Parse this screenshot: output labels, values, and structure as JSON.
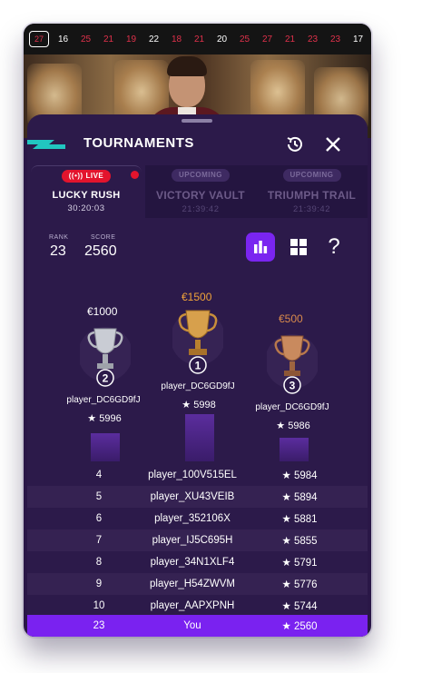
{
  "roulette_results": [
    {
      "n": "27",
      "color": "red"
    },
    {
      "n": "16",
      "color": "black"
    },
    {
      "n": "25",
      "color": "red"
    },
    {
      "n": "21",
      "color": "red"
    },
    {
      "n": "19",
      "color": "red"
    },
    {
      "n": "22",
      "color": "black"
    },
    {
      "n": "18",
      "color": "red"
    },
    {
      "n": "21",
      "color": "red"
    },
    {
      "n": "20",
      "color": "black"
    },
    {
      "n": "25",
      "color": "red"
    },
    {
      "n": "27",
      "color": "red"
    },
    {
      "n": "21",
      "color": "red"
    },
    {
      "n": "23",
      "color": "red"
    },
    {
      "n": "23",
      "color": "red"
    },
    {
      "n": "17",
      "color": "black"
    }
  ],
  "panel": {
    "title": "TOURNAMENTS",
    "tournaments": [
      {
        "badge": "LIVE",
        "name": "LUCKY RUSH",
        "time": "30:20:03"
      },
      {
        "badge": "UPCOMING",
        "name": "VICTORY VAULT",
        "time": "21:39:42"
      },
      {
        "badge": "UPCOMING",
        "name": "TRIUMPH TRAIL",
        "time": "21:39:42"
      }
    ],
    "rank_label": "RANK",
    "rank_value": "23",
    "score_label": "SCORE",
    "score_value": "2560",
    "help_label": "?"
  },
  "podium": [
    {
      "place": "2",
      "prize": "€1000",
      "player": "player_DC6GD9fJ",
      "score": "★ 5996",
      "prize_color": "#ffffff",
      "bar_fill": 0.6
    },
    {
      "place": "1",
      "prize": "€1500",
      "player": "player_DC6GD9fJ",
      "score": "★ 5998",
      "prize_color": "#f0a33a",
      "bar_fill": 1.0
    },
    {
      "place": "3",
      "prize": "€500",
      "player": "player_DC6GD9fJ",
      "score": "★ 5986",
      "prize_color": "#d98a4c",
      "bar_fill": 0.5
    }
  ],
  "leaderboard": [
    {
      "rank": "4",
      "player": "player_100V515EL",
      "score": "★ 5984"
    },
    {
      "rank": "5",
      "player": "player_XU43VEIB",
      "score": "★ 5894"
    },
    {
      "rank": "6",
      "player": "player_352106X",
      "score": "★ 5881"
    },
    {
      "rank": "7",
      "player": "player_IJ5C695H",
      "score": "★ 5855"
    },
    {
      "rank": "8",
      "player": "player_34N1XLF4",
      "score": "★ 5791"
    },
    {
      "rank": "9",
      "player": "player_H54ZWVM",
      "score": "★ 5776"
    },
    {
      "rank": "10",
      "player": "player_AAPXPNH",
      "score": "★ 5744"
    }
  ],
  "me_row": {
    "rank": "23",
    "player": "You",
    "score": "★ 2560"
  },
  "colors": {
    "accent": "#7a22f0",
    "live_red": "#e3142d",
    "panel_bg": "#2c1a4a"
  }
}
